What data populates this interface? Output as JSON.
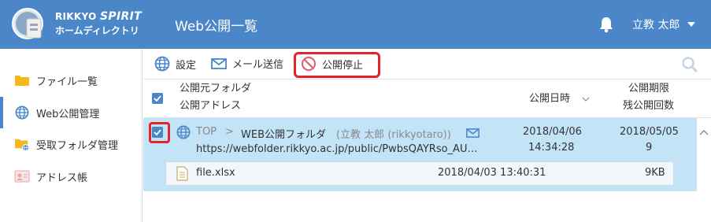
{
  "header": {
    "brand_line1_prefix": "RIKKYO ",
    "brand_line1_suffix": "SPIRIT",
    "brand_line2": "ホームディレクトリ",
    "title": "Web公開一覧",
    "user": "立教 太郎",
    "bg_color": "#4a86c8"
  },
  "sidebar": {
    "items": [
      {
        "label": "ファイル一覧",
        "icon": "folder-icon"
      },
      {
        "label": "Web公開管理",
        "icon": "globe-icon"
      },
      {
        "label": "受取フォルダ管理",
        "icon": "folder-globe-icon"
      },
      {
        "label": "アドレス帳",
        "icon": "address-book-icon"
      }
    ],
    "active_index": 1
  },
  "toolbar": {
    "settings": "設定",
    "send_mail": "メール送信",
    "stop_publish": "公開停止"
  },
  "table": {
    "headers": {
      "folder": "公開元フォルダ",
      "address": "公開アドレス",
      "date": "公開日時",
      "limit": "公開期限",
      "remaining": "残公開回数"
    },
    "rows": [
      {
        "crumb_top": "TOP",
        "crumb_sep": ">",
        "crumb_folder": "WEB公開フォルダ",
        "owner": "(立教 太郎 (rikkyotaro))",
        "url": "https://webfolder.rikkyo.ac.jp/public/PwbsQAYRso_AU…",
        "date": "2018/04/06",
        "time": "14:34:28",
        "limit_date": "2018/05/05",
        "limit_count": "9",
        "checked": true,
        "file": {
          "name": "file.xlsx",
          "datetime": "2018/04/03 13:40:31",
          "size": "9KB"
        }
      }
    ]
  },
  "colors": {
    "accent": "#4a86c8",
    "selected_row": "#c3e3f7",
    "highlight_box": "#e0242a"
  }
}
